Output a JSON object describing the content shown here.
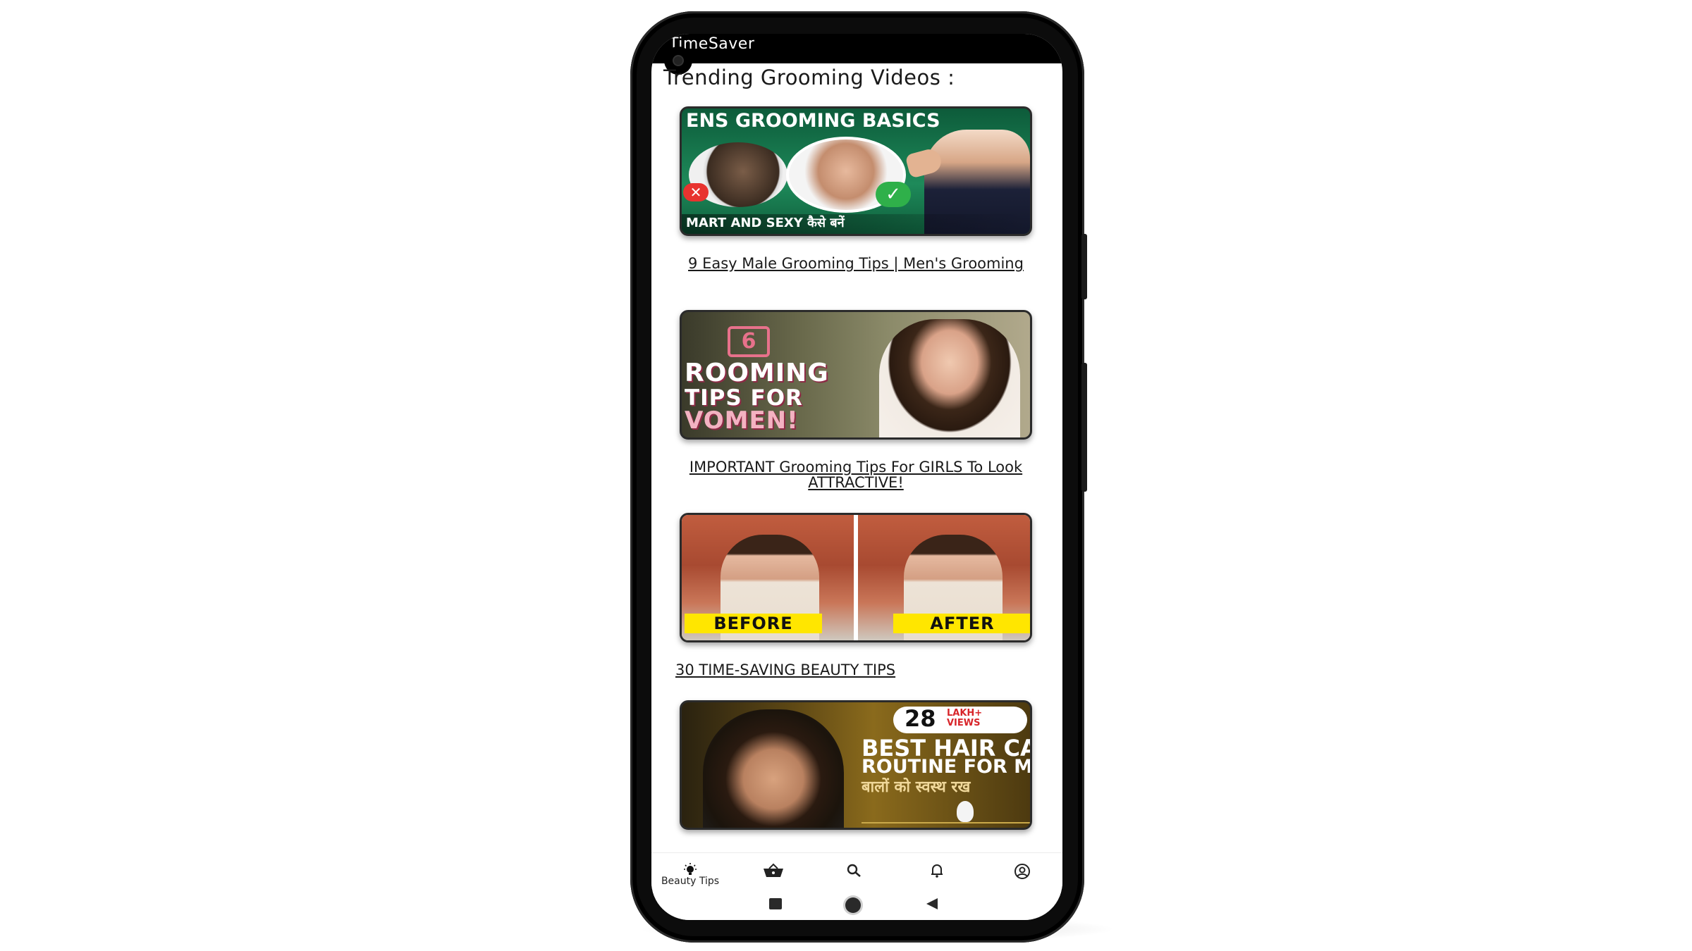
{
  "app": {
    "title": "TimeSaver"
  },
  "section": {
    "heading": "Trending Grooming Videos :"
  },
  "videos": [
    {
      "title": "9 Easy Male Grooming Tips | Men's Grooming",
      "thumb_text_top": "ENS GROOMING BASICS",
      "thumb_text_bottom": "MART AND SEXY कैसे बनें",
      "thumb_cross": "✕",
      "thumb_check": "✓"
    },
    {
      "title": "IMPORTANT Grooming Tips For GIRLS To Look ATTRACTIVE!",
      "thumb_number": "6",
      "thumb_line1": "ROOMING",
      "thumb_line2": "TIPS FOR",
      "thumb_line3": "VOMEN!"
    },
    {
      "title": "30 TIME-SAVING BEAUTY TIPS",
      "thumb_before": "BEFORE",
      "thumb_after": "AFTER"
    },
    {
      "thumb_badge_number": "28",
      "thumb_badge_sub1": "LAKH+",
      "thumb_badge_sub2": "VIEWS",
      "thumb_line1": "BEST HAIR CAF",
      "thumb_line2": "ROUTINE FOR ME",
      "thumb_line3": "बालों को स्वस्थ रख"
    }
  ],
  "bottom_nav": {
    "items": [
      {
        "label": "Beauty Tips",
        "icon": "lightbulb-icon",
        "active": true
      },
      {
        "label": "",
        "icon": "basket-icon"
      },
      {
        "label": "",
        "icon": "search-icon"
      },
      {
        "label": "",
        "icon": "bell-icon"
      },
      {
        "label": "",
        "icon": "account-icon"
      }
    ]
  },
  "colors": {
    "status_bar": "#000000",
    "background": "#ffffff",
    "text": "#1a1a1a",
    "thumb_label_yellow": "#ffe600"
  }
}
